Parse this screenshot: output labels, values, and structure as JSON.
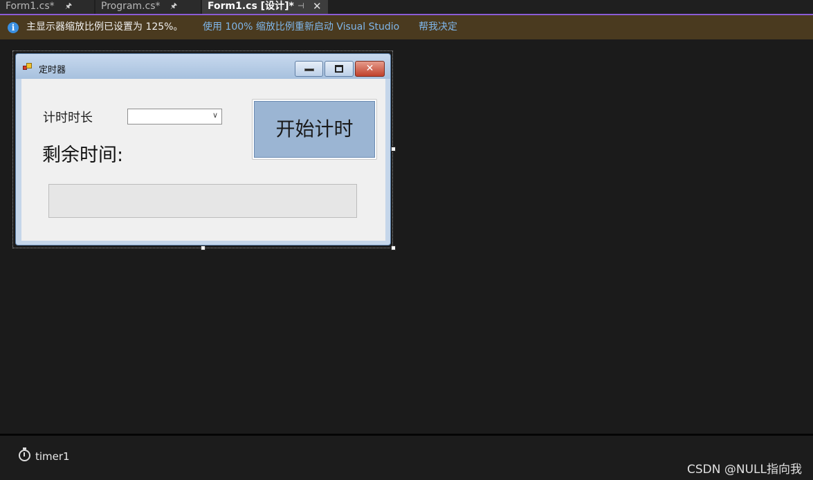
{
  "tabs": [
    {
      "label": "Form1.cs*",
      "pin": "🖈"
    },
    {
      "label": "Program.cs*",
      "pin": "🖈"
    },
    {
      "label": "Form1.cs [设计]*",
      "pin": "⊣",
      "close": "✕"
    }
  ],
  "infobar": {
    "icon": "i",
    "message": "主显示器缩放比例已设置为 125%。",
    "link_restart": "使用 100% 缩放比例重新启动 Visual Studio",
    "link_decide": "帮我决定"
  },
  "form": {
    "title": "定时器",
    "label_duration": "计时时长",
    "combo_value": "",
    "combo_chevron": "∨",
    "label_remaining": "剩余时间:",
    "start_button": "开始计时"
  },
  "tray": {
    "component": "timer1"
  },
  "watermark": "CSDN @NULL指向我",
  "colors": {
    "accent": "#8b5cd6",
    "infobar_bg": "#4a3a1f",
    "link": "#7fb6ea",
    "button_face": "#9bb5d3"
  }
}
